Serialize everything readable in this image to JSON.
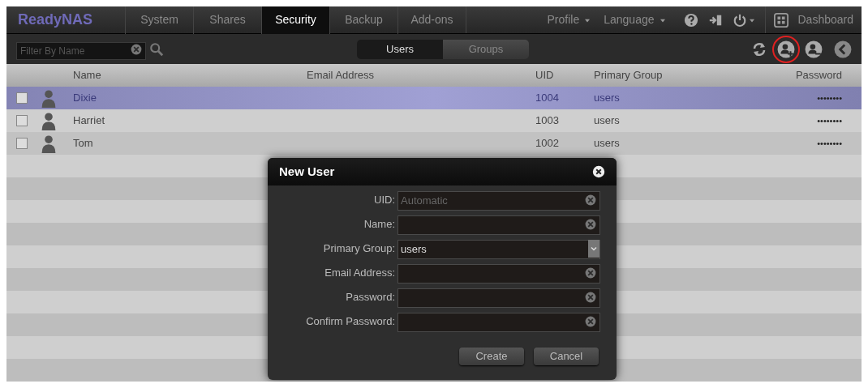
{
  "nav": {
    "logo": "ReadyNAS",
    "tabs": [
      {
        "label": "System",
        "selected": false
      },
      {
        "label": "Shares",
        "selected": false
      },
      {
        "label": "Security",
        "selected": true
      },
      {
        "label": "Backup",
        "selected": false
      },
      {
        "label": "Add-ons",
        "selected": false
      }
    ],
    "menus": [
      "Profile",
      "Language"
    ],
    "dashboard": "Dashboard"
  },
  "toolbar": {
    "filter": {
      "placeholder": "Filter By Name"
    },
    "segments": [
      {
        "label": "Users",
        "selected": true
      },
      {
        "label": "Groups",
        "selected": false
      }
    ]
  },
  "table": {
    "columns": [
      "Name",
      "Email Address",
      "UID",
      "Primary Group",
      "Password"
    ],
    "rows": [
      {
        "checked": false,
        "selected": true,
        "name": "Dixie",
        "uid": "1004",
        "group": "users",
        "password": "••••••••"
      },
      {
        "checked": false,
        "selected": false,
        "name": "Harriet",
        "uid": "1003",
        "group": "users",
        "password": "••••••••"
      },
      {
        "checked": false,
        "selected": false,
        "name": "Tom",
        "uid": "1002",
        "group": "users",
        "password": "••••••••"
      }
    ]
  },
  "dialog": {
    "title": "New User",
    "fields": [
      {
        "kind": "text",
        "label": "UID:",
        "placeholder": "Automatic"
      },
      {
        "kind": "text",
        "label": "Name:"
      },
      {
        "kind": "select",
        "label": "Primary Group:",
        "value": "users"
      },
      {
        "kind": "text",
        "label": "Email Address:"
      },
      {
        "kind": "text",
        "label": "Password:"
      },
      {
        "kind": "text",
        "label": "Confirm Password:"
      }
    ],
    "buttons": [
      "Create",
      "Cancel"
    ]
  }
}
